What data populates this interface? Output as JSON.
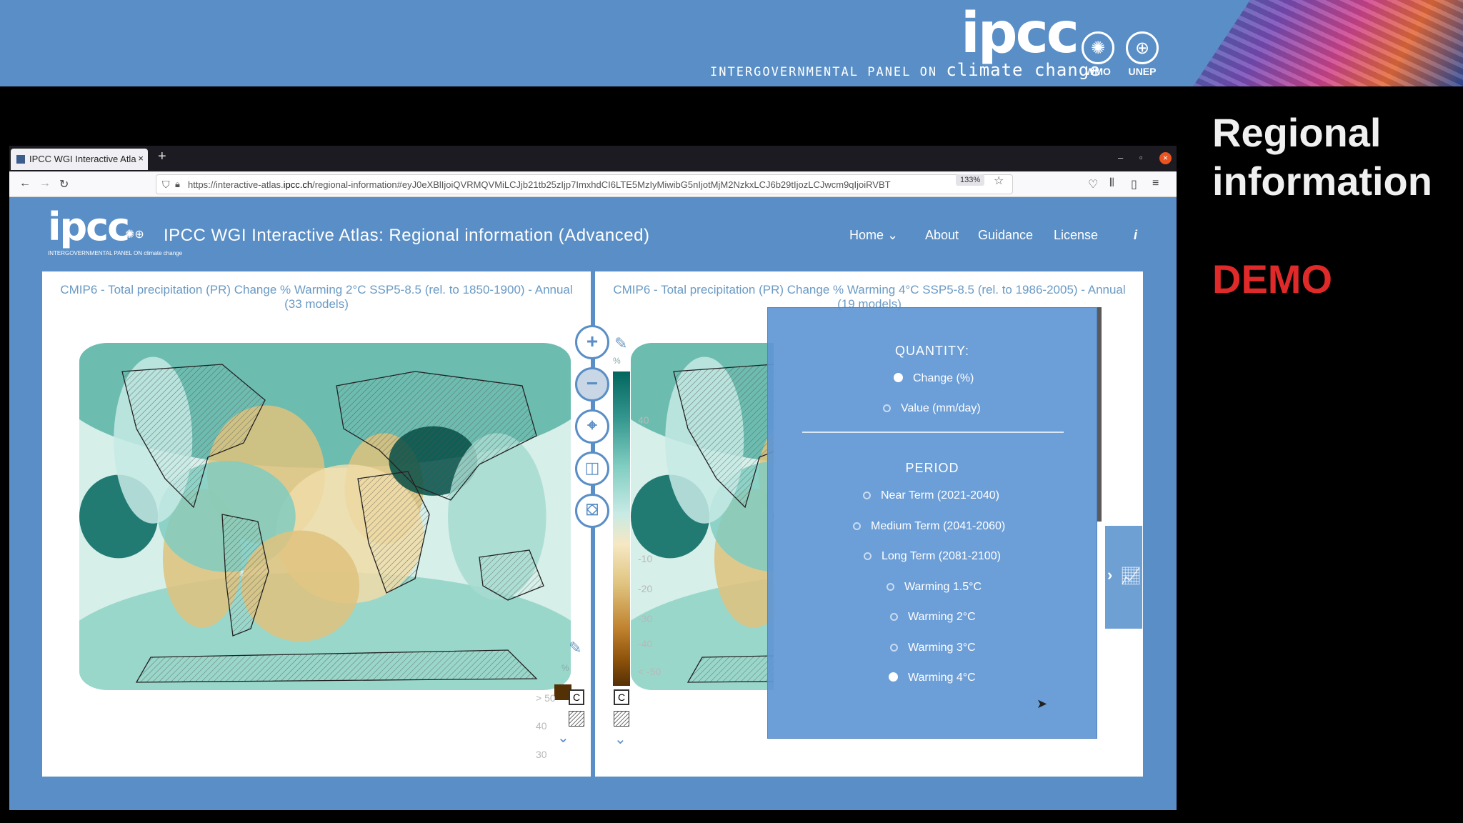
{
  "banner": {
    "logo_text": "ipcc",
    "subtitle_prefix": "INTERGOVERNMENTAL PANEL ON ",
    "subtitle_emphasis": "climate change",
    "org1": "WMO",
    "org2": "UNEP"
  },
  "slide": {
    "title": "Regional\ninformation",
    "demo": "DEMO"
  },
  "browser": {
    "tab_title": "IPCC WGI Interactive Atla",
    "tab_close": "×",
    "new_tab": "+",
    "url_prefix": "https://interactive-atlas.",
    "url_domain": "ipcc.ch",
    "url_rest": "/regional-information#eyJ0eXBlIjoiQVRMQVMiLCJjb21tb25zIjp7ImxhdCI6LTE5MzIyMiwibG5nIjotMjM2NzkxLCJ6b29tIjozLCJwcm9qIjoiRVBT",
    "zoom": "133%"
  },
  "app": {
    "logo": "ipcc",
    "logo_sub": "INTERGOVERNMENTAL PANEL ON climate change",
    "title": "IPCC WGI Interactive Atlas: Regional information (Advanced)",
    "nav": [
      "Home",
      "About",
      "Guidance",
      "License"
    ],
    "info": "i"
  },
  "panels": {
    "left_title": "CMIP6 - Total precipitation (PR) Change % Warming 2°C SSP5-8.5 (rel. to 1850-1900) - Annual (33 models)",
    "right_title": "CMIP6 - Total precipitation (PR) Change % Warming 4°C SSP5-8.5 (rel. to 1986-2005) - Annual (19 models)",
    "pct_unit": "%"
  },
  "legend": {
    "left_values": [
      "> 50",
      "40",
      "30"
    ],
    "right_values": [
      "40",
      "-10",
      "-20",
      "-30",
      "-40",
      "< -50"
    ],
    "c_label": "C"
  },
  "dropdown": {
    "quantity_header": "QUANTITY:",
    "quantity_options": [
      {
        "label": "Change (%)",
        "selected": true
      },
      {
        "label": "Value (mm/day)",
        "selected": false
      }
    ],
    "period_header": "PERIOD",
    "period_options": [
      {
        "label": "Near Term (2021-2040)",
        "selected": false
      },
      {
        "label": "Medium Term (2041-2060)",
        "selected": false
      },
      {
        "label": "Long Term (2081-2100)",
        "selected": false
      },
      {
        "label": "Warming 1.5°C",
        "selected": false
      },
      {
        "label": "Warming 2°C",
        "selected": false
      },
      {
        "label": "Warming 3°C",
        "selected": false
      },
      {
        "label": "Warming 4°C",
        "selected": true
      }
    ]
  },
  "colors": {
    "brand_blue": "#5a8ec6",
    "teal_wet": "#01665e",
    "brown_dry": "#8c510a",
    "demo_red": "#e02a2a"
  }
}
